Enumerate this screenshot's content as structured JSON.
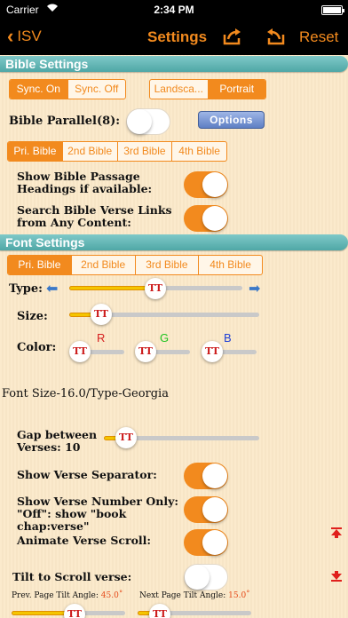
{
  "status": {
    "carrier": "Carrier",
    "time": "2:34 PM"
  },
  "nav": {
    "back_label": "ISV",
    "title": "Settings",
    "reset_label": "Reset"
  },
  "bible_settings": {
    "header": "Bible Settings",
    "sync_options": [
      "Sync. On",
      "Sync. Off"
    ],
    "orientation_options": [
      "Landsca...",
      "Portrait"
    ],
    "parallel_label": "Bible Parallel(8):",
    "parallel_toggle": "off",
    "options_label": "Options",
    "bible_tabs": [
      "Pri. Bible",
      "2nd Bible",
      "3rd Bible",
      "4th Bible"
    ],
    "headings_label": "Show Bible Passage Headings if available:",
    "links_label": "Search Bible Verse Links from Any Content:"
  },
  "font_settings": {
    "header": "Font Settings",
    "bible_tabs": [
      "Pri. Bible",
      "2nd Bible",
      "3rd Bible",
      "4th Bible"
    ],
    "type_label": "Type:",
    "size_label": "Size:",
    "color_label": "Color:",
    "color_channels": [
      "R",
      "G",
      "B"
    ],
    "thumb_text": "TT",
    "summary": "Font Size-16.0/Type-Georgia",
    "type_level": 0.5,
    "size_level": 0.1
  },
  "verse_settings": {
    "gap_label": "Gap between Verses: 10",
    "gap_level": 0.1,
    "separator_label": "Show Verse Separator:",
    "number_only_label": "Show Verse Number Only: \"Off\": show \"book chap:verse\"",
    "animate_label": "Animate Verse Scroll:",
    "tilt_label": "Tilt to Scroll verse:",
    "tilt_toggle": "off",
    "prev_tilt_label": "Prev. Page Tilt Angle:",
    "prev_tilt_value": "45.0˚",
    "next_tilt_label": "Next Page Tilt Angle:",
    "next_tilt_value": "15.0˚"
  },
  "colors": {
    "accent": "#f28a1e",
    "header": "#5fb4b3",
    "background": "#fbe9c9"
  }
}
